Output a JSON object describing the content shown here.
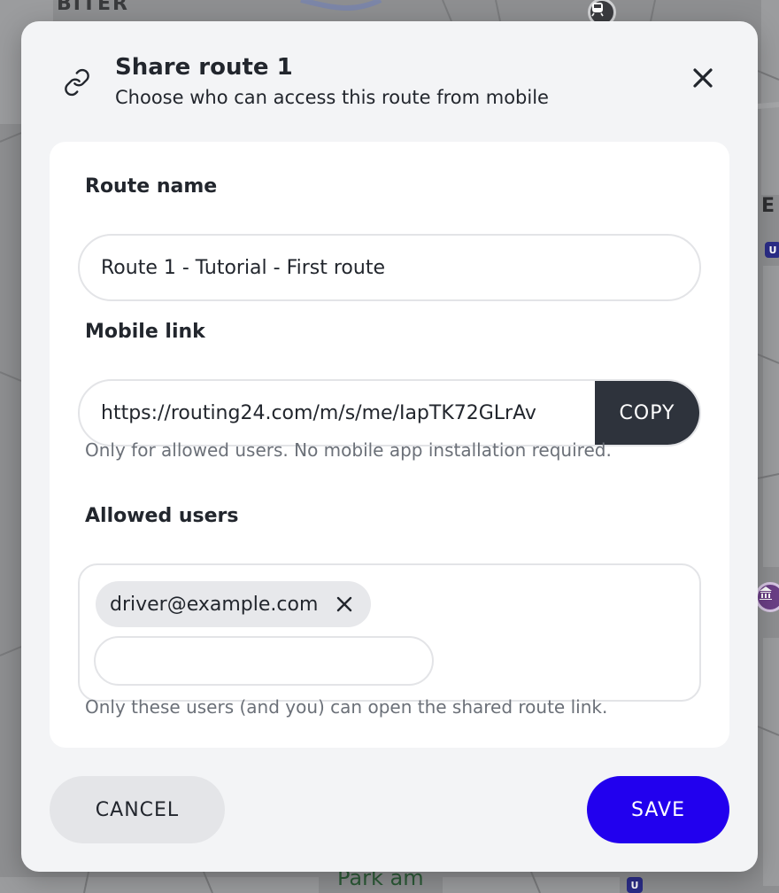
{
  "map": {
    "label_top_left": "BITER",
    "label_right": "E",
    "label_park": "Park am",
    "ubahn_badge": "U"
  },
  "dialog": {
    "title": "Share route 1",
    "subtitle": "Choose who can access this route from mobile",
    "header_icon": "link-icon",
    "close_icon": "close-icon"
  },
  "form": {
    "route_name_label": "Route name",
    "route_name_value": "Route 1 - Tutorial - First route",
    "mobile_link_label": "Mobile link",
    "mobile_link_value": "https://routing24.com/m/s/me/IapTK72GLrAv",
    "copy_label": "COPY",
    "mobile_link_help": "Only for allowed users. No mobile app installation required.",
    "allowed_users_label": "Allowed users",
    "allowed_users": [
      "driver@example.com"
    ],
    "new_user_value": "",
    "allowed_users_help": "Only these users (and you) can open the shared route link."
  },
  "actions": {
    "cancel_label": "CANCEL",
    "save_label": "SAVE"
  },
  "colors": {
    "primary": "#2200ee",
    "copy_button": "#2e333c",
    "dialog_bg": "#f3f4f6",
    "card_bg": "#ffffff"
  }
}
